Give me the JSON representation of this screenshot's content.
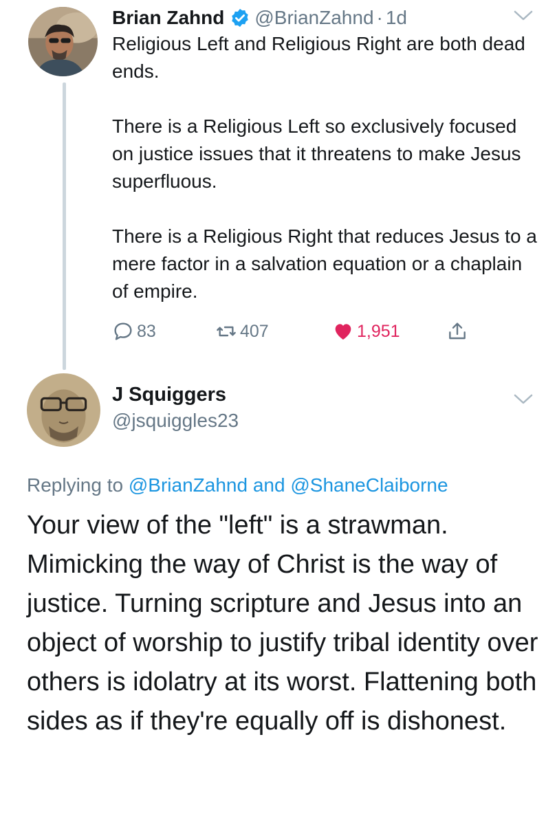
{
  "tweet1": {
    "display_name": "Brian Zahnd",
    "handle": "@BrianZahnd",
    "separator": "·",
    "time": "1d",
    "paragraphs": [
      "Religious Left and Religious Right are both dead ends.",
      "There is a Religious Left so exclusively focused on justice issues that it threatens to make Jesus superfluous.",
      "There is a Religious Right that reduces Jesus to a mere factor in a salvation equation or a chaplain of empire."
    ],
    "reply_count": "83",
    "retweet_count": "407",
    "like_count": "1,951",
    "verified_icon": "verified-badge-icon",
    "liked": true
  },
  "tweet2": {
    "display_name": "J Squiggers",
    "handle": "@jsquiggles23",
    "replying_prefix": "Replying to",
    "replying_user1": "@BrianZahnd",
    "replying_and": "and",
    "replying_user2": "@ShaneClaiborne",
    "body": "Your view of the \"left\" is a strawman. Mimicking the way of Christ is the way of justice. Turning scripture and Jesus into an object of worship to justify tribal identity over others is idolatry at its worst. Flattening both sides as if they're equally off is dishonest."
  },
  "colors": {
    "text": "#14171a",
    "secondary": "#657786",
    "link": "#1b95e0",
    "like": "#e0245e",
    "verified": "#1da1f2",
    "thread_line": "#ccd6dd"
  }
}
